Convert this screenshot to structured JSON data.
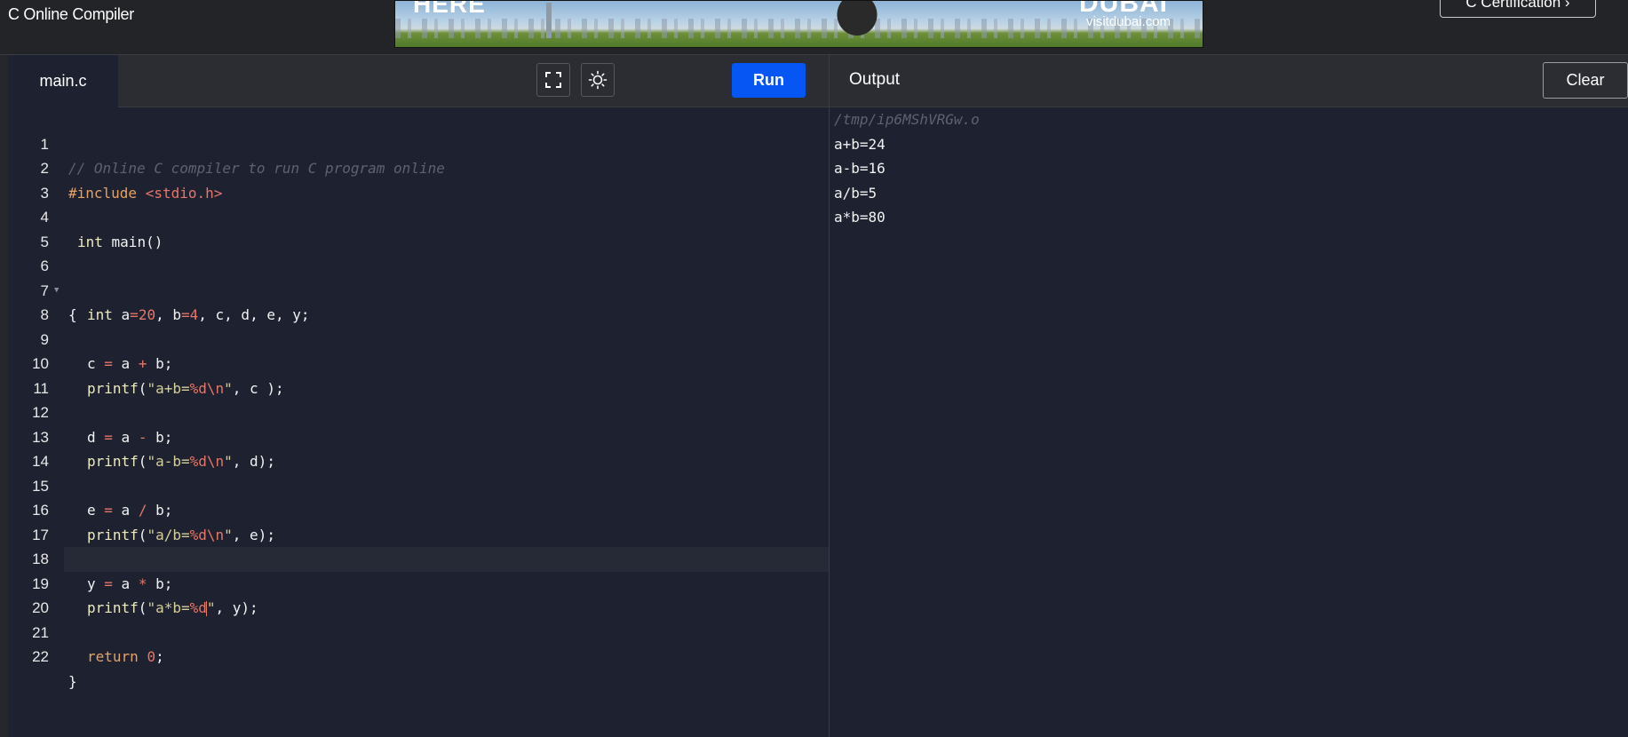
{
  "app": {
    "title": "C Online Compiler",
    "cert_button_label": "C Certification ›"
  },
  "ad": {
    "headline": "HERE",
    "logo_text": "DUBAI",
    "url_text": "visitdubai.com"
  },
  "editor": {
    "file_tab": "main.c",
    "fullscreen_icon": "fullscreen-icon",
    "theme_icon": "sun-icon",
    "run_label": "Run",
    "line_numbers": [
      "1",
      "2",
      "3",
      "4",
      "5",
      "6",
      "7",
      "8",
      "9",
      "10",
      "11",
      "12",
      "13",
      "14",
      "15",
      "16",
      "17",
      "18",
      "19",
      "20",
      "21",
      "22"
    ],
    "active_line": 19,
    "code": {
      "l1_comment": "// Online C compiler to run C program online",
      "l2_directive": "#include ",
      "l2_header": "<stdio.h>",
      "l4_kw": "int",
      "l4_rest": " main()",
      "l6": "{",
      "l7_kw": "int",
      "l7_a": " a",
      "l7_eq1": "=",
      "l7_n1": "20",
      "l7_b": ", b",
      "l7_eq2": "=",
      "l7_n2": "4",
      "l7_rest": ", c, d, e, y;",
      "l9_c": "c ",
      "l9_eq": "=",
      "l9_a": " a ",
      "l9_op": "+",
      "l9_b": " b;",
      "l10_fn": "printf",
      "l10_open": "(",
      "l10_str": "\"a+b=",
      "l10_fmt": "%d\\n",
      "l10_q": "\"",
      "l10_rest": ", c );",
      "l12_d": "d ",
      "l12_eq": "=",
      "l12_a": " a ",
      "l12_op": "-",
      "l12_b": " b;",
      "l13_fn": "printf",
      "l13_open": "(",
      "l13_str": "\"a-b=",
      "l13_fmt": "%d\\n",
      "l13_q": "\"",
      "l13_rest": ", d);",
      "l15_e": "e ",
      "l15_eq": "=",
      "l15_a": " a ",
      "l15_op": "/",
      "l15_b": " b;",
      "l16_fn": "printf",
      "l16_open": "(",
      "l16_str": "\"a/b=",
      "l16_fmt": "%d\\n",
      "l16_q": "\"",
      "l16_rest": ", e);",
      "l18_y": "y ",
      "l18_eq": "=",
      "l18_a": " a ",
      "l18_op": "*",
      "l18_b": " b;",
      "l19_fn": "printf",
      "l19_open": "(",
      "l19_str": "\"a*b=",
      "l19_fmt": "%d",
      "l19_q": "\"",
      "l19_rest": ", y);",
      "l21_kw": "return",
      "l21_sp": " ",
      "l21_num": "0",
      "l21_rest": ";",
      "l22": "}"
    }
  },
  "output": {
    "title": "Output",
    "clear_label": "Clear",
    "lines": [
      "/tmp/ip6MShVRGw.o",
      "a+b=24",
      "a-b=16",
      "a/b=5",
      "a*b=80"
    ]
  }
}
